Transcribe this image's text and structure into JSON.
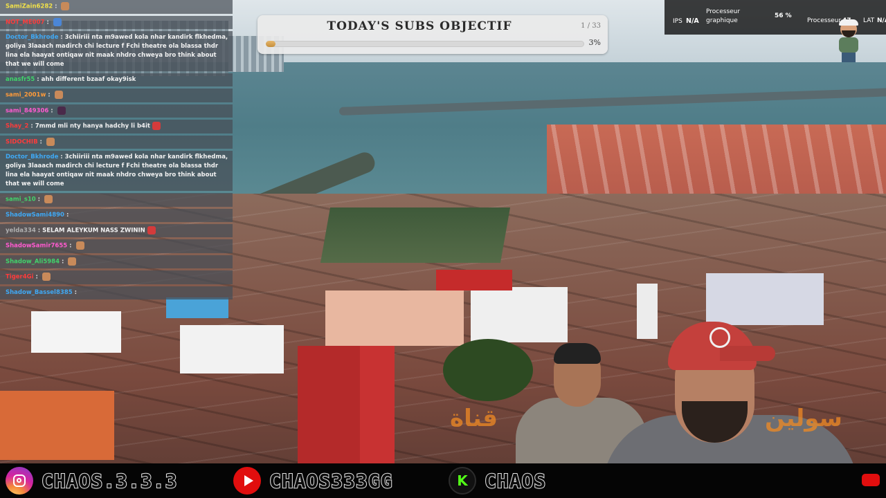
{
  "chat": {
    "messages": [
      {
        "user": "SamiZain6282",
        "color": "#f0e04a",
        "text": "",
        "emote": true,
        "emote_style": ""
      },
      {
        "user": "NOT_ME007",
        "color": "#ff3b3b",
        "text": "",
        "emote": true,
        "emote_style": "blue"
      },
      {
        "user": "Doctor_Bkhrode",
        "color": "#3fa9f5",
        "text": "3chiiriii nta m9awed kola nhar kandirk flkhedma, goliya 3laaach madirch chi lecture f Fchi theatre ola blassa thdr lina ela haayat ontiqaw nit maak nhdro chweya bro think about that we will come",
        "emote": false,
        "emote_style": ""
      },
      {
        "user": "anasfr55",
        "color": "#41d36b",
        "text": "ahh different bzaaf okay9isk",
        "emote": false,
        "emote_style": ""
      },
      {
        "user": "sami_2001w",
        "color": "#ff9b3a",
        "text": "",
        "emote": true,
        "emote_style": ""
      },
      {
        "user": "sami_849306",
        "color": "#ff5ad0",
        "text": "",
        "emote": true,
        "emote_style": "dark"
      },
      {
        "user": "Shay_2",
        "color": "#ff3b3b",
        "text": "7mmd mli nty hanya hadchy li b4it",
        "emote": true,
        "emote_style": "red"
      },
      {
        "user": "SIDOCHIB",
        "color": "#ff3b3b",
        "text": "",
        "emote": true,
        "emote_style": ""
      },
      {
        "user": "Doctor_Bkhrode",
        "color": "#3fa9f5",
        "text": "3chiiriii nta m9awed kola nhar kandirk flkhedma, goliya 3laaach madirch chi lecture f Fchi theatre ola blassa thdr lina ela haayat ontiqaw nit maak nhdro chweya bro think about that we will come",
        "emote": false,
        "emote_style": ""
      },
      {
        "user": "sami_s10",
        "color": "#41d36b",
        "text": "",
        "emote": true,
        "emote_style": ""
      },
      {
        "user": "ShadowSami4890",
        "color": "#3fa9f5",
        "text": "",
        "emote": false,
        "emote_style": ""
      },
      {
        "user": "yelda334",
        "color": "#b0b0b0",
        "text": "SELAM ALEYKUM NASS ZWININ",
        "emote": true,
        "emote_style": "red"
      },
      {
        "user": "ShadowSamir7655",
        "color": "#ff5ad0",
        "text": "",
        "emote": true,
        "emote_style": ""
      },
      {
        "user": "Shadow_Ali5984",
        "color": "#41d36b",
        "text": "",
        "emote": true,
        "emote_style": ""
      },
      {
        "user": "Tiger4Gi",
        "color": "#ff3b3b",
        "text": "",
        "emote": true,
        "emote_style": ""
      },
      {
        "user": "Shadow_Bassel8385",
        "color": "#3fa9f5",
        "text": "",
        "emote": false,
        "emote_style": ""
      }
    ]
  },
  "subs": {
    "title": "TODAY'S SUBS OBJECTIF",
    "count": "1 / 33",
    "percent_label": "3%",
    "progress": 0.03
  },
  "stats": {
    "ips_label": "IPS",
    "ips_value": "N/A",
    "gpu_label_1": "Processeur",
    "gpu_label_2": "graphique",
    "gpu_value": "56 %",
    "cpu_label": "Processeur",
    "cpu_value": "47",
    "lat_label": "LAT",
    "lat_value": "N/A"
  },
  "overlay_text": {
    "arabic_left": "ﻗﻨﺎﺓ",
    "arabic_right": "ﺳﻮﻟﻴﻦ"
  },
  "social": {
    "instagram": {
      "icon": "instagram-icon",
      "handle": "CHAOS.3.3.3"
    },
    "youtube": {
      "icon": "youtube-icon",
      "handle": "CHAOS333GG"
    },
    "kick": {
      "icon": "kick-icon",
      "glyph": "K",
      "handle": "CHAOS"
    }
  },
  "colors": {
    "subs_fill": "#c58f3d",
    "social_bg": "#050505",
    "kick_green": "#53fc18",
    "youtube_red": "#e10e0e"
  }
}
